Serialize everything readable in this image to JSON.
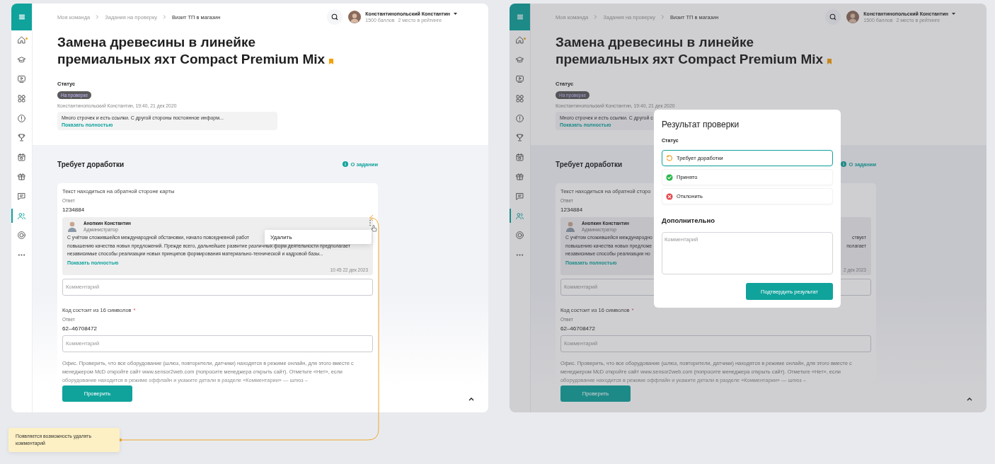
{
  "screens": [
    {
      "sidebar": {
        "items": [
          {
            "kind": "home",
            "selected": false,
            "dot": true
          },
          {
            "kind": "cap",
            "selected": false,
            "dot": false
          },
          {
            "kind": "video",
            "selected": false,
            "dot": false
          },
          {
            "kind": "grid",
            "selected": false,
            "dot": false
          },
          {
            "kind": "info",
            "selected": false,
            "dot": false
          },
          {
            "kind": "trophy",
            "selected": false,
            "dot": false
          },
          {
            "kind": "calendar",
            "selected": false,
            "dot": false
          },
          {
            "kind": "gift",
            "selected": false,
            "dot": false
          },
          {
            "kind": "chat",
            "selected": false,
            "dot": false
          },
          {
            "kind": "people",
            "selected": true,
            "dot": false
          },
          {
            "kind": "support",
            "selected": false,
            "dot": false
          },
          {
            "kind": "more",
            "selected": false,
            "dot": false
          }
        ]
      },
      "breadcrumbs": [
        {
          "label": "Моя команда",
          "current": false
        },
        {
          "label": "Задания на проверку",
          "current": false
        },
        {
          "label": "Визит ТП в магазин",
          "current": true
        }
      ],
      "user": {
        "name": "Константинопольский Константин",
        "stats": [
          "1500 баллов",
          "2 место в рейтинге"
        ]
      },
      "title": "Замена древесины в линейке премиальных яхт Compact Premium Mix",
      "bookmarked": true,
      "status": {
        "label": "Статус",
        "badge": "На проверке",
        "author": "Константинопольский Константин, 19:40, 21 дек 2020",
        "note": "Много строчек и есть ссылки. С другой стороны постоянное информ...",
        "show_more": "Показать полностью"
      },
      "section": {
        "title": "Требует доработки",
        "about_link": "О задании"
      },
      "questions": [
        {
          "question": "Текст находиться на обратной стороне карты",
          "answer_label": "Ответ",
          "answer": "1234884",
          "comment": {
            "author": "Анопкин Константин",
            "role": "Администратор",
            "lines": [
              [
                "С учётом сложившейся международной обстановки, начало повседневной работ"
              ],
              [
                "повышению качества новых предложений. Прежде всего, дальнейшее развитие различных форм деятельности предполагает"
              ],
              [
                "независимые способы реализации новых принципов формирования материально-технической и кадровой базы..."
              ]
            ],
            "show_more": "Показать полностью",
            "time": "10:45 22 дек 2023",
            "menu": {
              "items": [
                "Удалить"
              ]
            }
          },
          "comment_placeholder": "Комментарий"
        },
        {
          "question": "Код состоит из 16 символов",
          "required_mark": "*",
          "answer_label": "Ответ",
          "answer": "62–46708472",
          "comment_placeholder": "Комментарий"
        }
      ],
      "description": "Офис. Проверить, что все оборудование (шлюз, повторители, датчики) находятся в режиме онлайн, для этого вместе с менеджером McD откройте сайт www.sensor2web.com (попросите менеджера открыть сайт). Отметьте «Нет», если оборудование находится в режиме оффлайн и укажите детали в разделе «Комментарии» — шлюз –",
      "submit": "Проверить"
    },
    {
      "sidebar": {
        "items": [
          {
            "kind": "home",
            "selected": false,
            "dot": true
          },
          {
            "kind": "cap",
            "selected": false,
            "dot": false
          },
          {
            "kind": "video",
            "selected": false,
            "dot": false
          },
          {
            "kind": "grid",
            "selected": false,
            "dot": false
          },
          {
            "kind": "info",
            "selected": false,
            "dot": false
          },
          {
            "kind": "trophy",
            "selected": false,
            "dot": false
          },
          {
            "kind": "calendar",
            "selected": false,
            "dot": false
          },
          {
            "kind": "gift",
            "selected": false,
            "dot": false
          },
          {
            "kind": "chat",
            "selected": false,
            "dot": false
          },
          {
            "kind": "people",
            "selected": true,
            "dot": false
          },
          {
            "kind": "support",
            "selected": false,
            "dot": false
          },
          {
            "kind": "more",
            "selected": false,
            "dot": false
          }
        ]
      },
      "breadcrumbs": [
        {
          "label": "Моя команда",
          "current": false
        },
        {
          "label": "Задания на проверку",
          "current": false
        },
        {
          "label": "Визит ТП в магазин",
          "current": true
        }
      ],
      "user": {
        "name": "Константинопольский Константин",
        "stats": [
          "1500 баллов",
          "2 место в рейтинге"
        ]
      },
      "title": "Замена древесины в линейке премиальных яхт Compact Premium Mix",
      "bookmarked": true,
      "status": {
        "label": "Статус",
        "badge": "На проверке",
        "author": "Константинопольский Константин, 19:40, 21 дек 2020",
        "note": "Много строчек и есть ссылки. С другой с",
        "show_more": "Показать полностью"
      },
      "section": {
        "title": "Требует доработки",
        "about_link": "О задании"
      },
      "questions": [
        {
          "question": "Текст находиться на обратной сторо",
          "answer_label": "Ответ",
          "answer": "1234884",
          "comment": {
            "author": "Анопкин Константин",
            "role": "Администратор",
            "lines": [
              [
                "С учётом сложившейся международно",
                "ствует"
              ],
              [
                "повышению качества новых предложе",
                "полагает"
              ],
              [
                "независимые способы реализации но"
              ]
            ],
            "show_more": "Показать полностью",
            "time": "2 дек 2023"
          },
          "comment_placeholder": "Комментарий"
        },
        {
          "question": "Код состоит из 16 символов",
          "required_mark": "*",
          "answer_label": "Ответ",
          "answer": "62–46708472",
          "comment_placeholder": "Комментарий"
        }
      ],
      "description": "Офис. Проверить, что все оборудование (шлюз, повторители, датчики) находятся в режиме онлайн, для этого вместе с менеджером McD откройте сайт www.sensor2web.com (попросите менеджера открыть сайт). Отметьте «Нет», если оборудование находится в режиме оффлайн и укажите детали в разделе «Комментарии» — шлюз –",
      "submit": "Проверить",
      "modal": {
        "title": "Результат проверки",
        "status_label": "Статус",
        "options": [
          {
            "kind": "rework",
            "label": "Требует доработки",
            "selected": true
          },
          {
            "kind": "accepted",
            "label": "Принято",
            "selected": false
          },
          {
            "kind": "rejected",
            "label": "Отклонить",
            "selected": false
          }
        ],
        "extra_label": "Дополнительно",
        "comment_placeholder": "Комментарий",
        "confirm": "Подтвердить результат"
      }
    }
  ],
  "annotation": {
    "text": "Появляется возможность удалять комментарий"
  }
}
